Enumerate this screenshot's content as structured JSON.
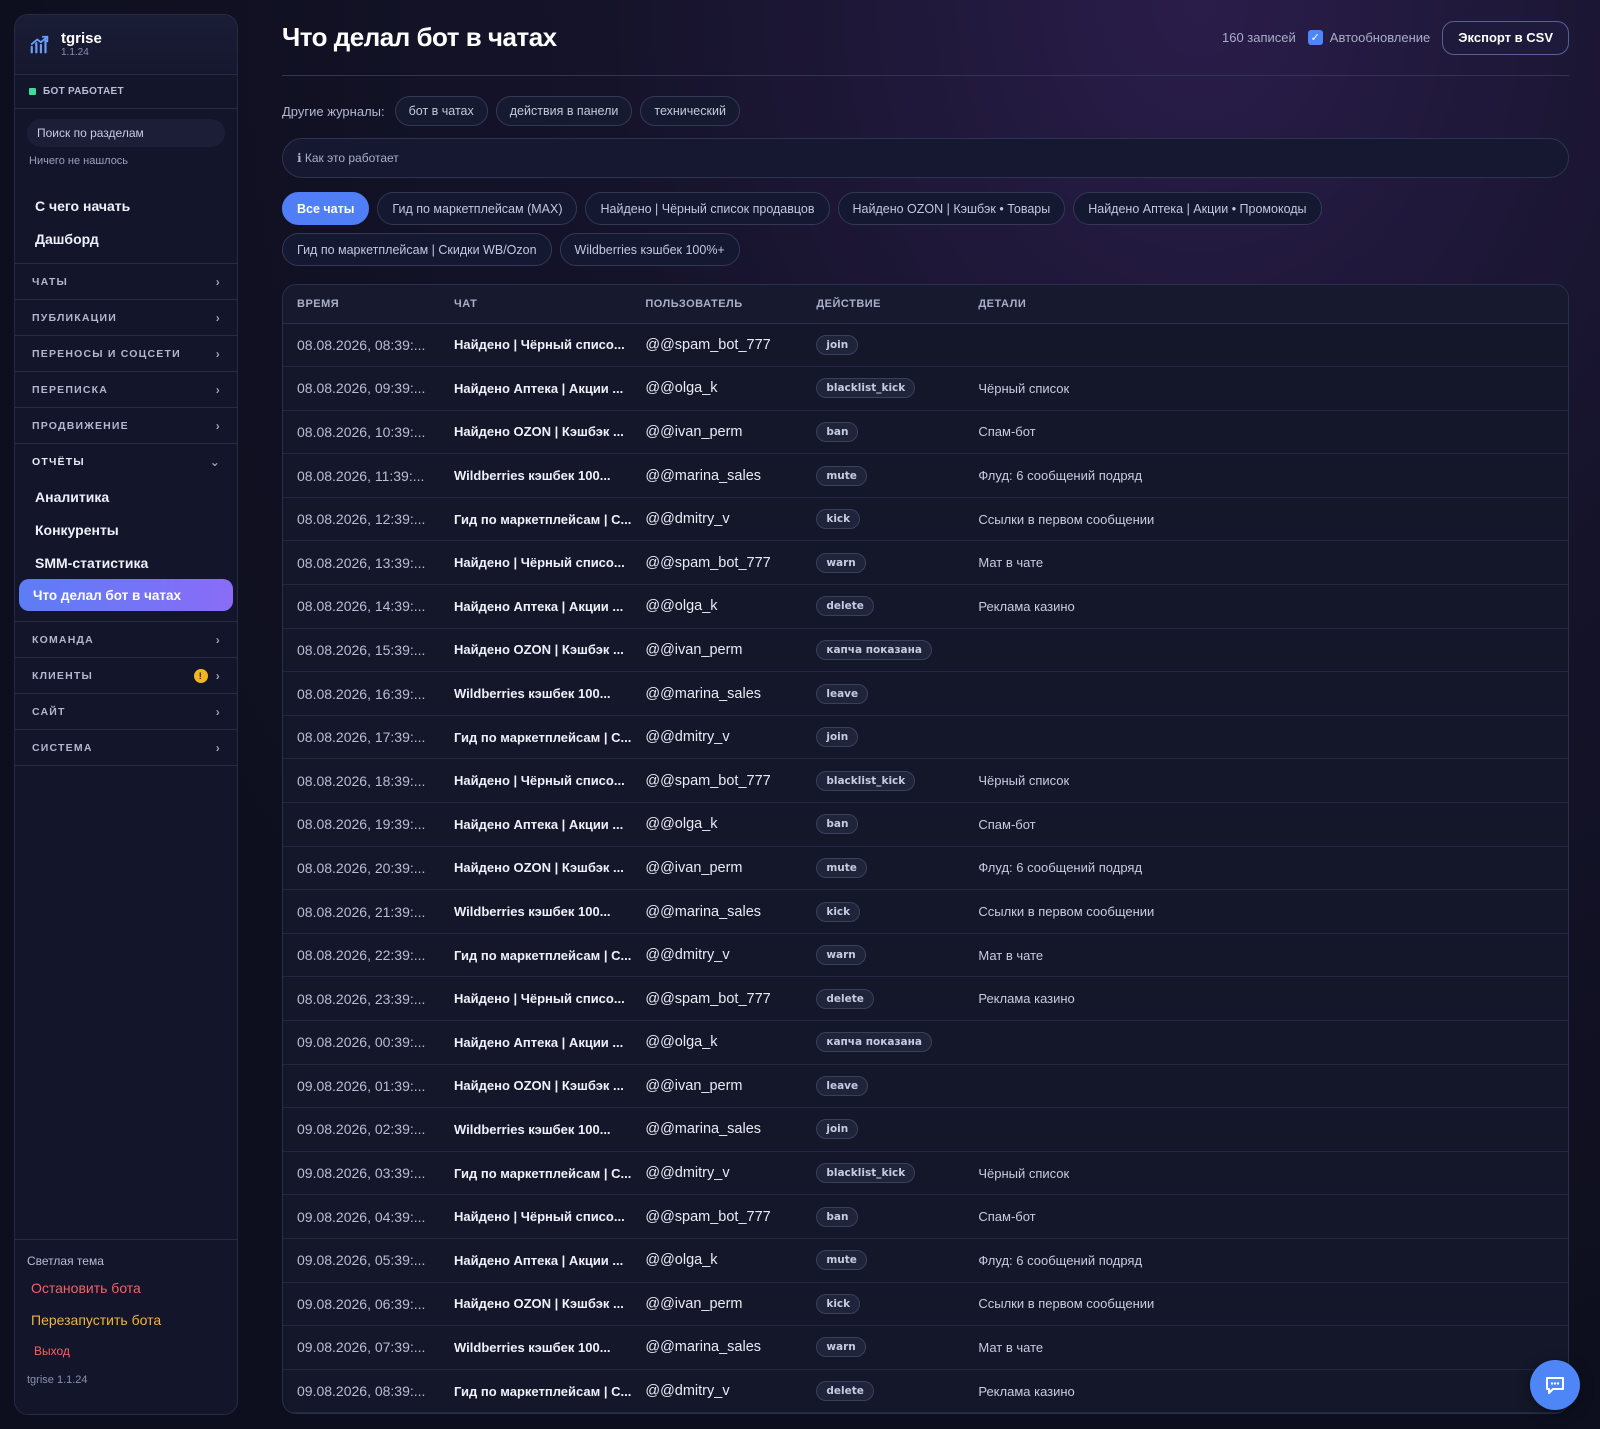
{
  "brand": {
    "name": "tgrise",
    "version": "1.1.24"
  },
  "sidebar": {
    "status": "БОТ РАБОТАЕТ",
    "search_placeholder": "Поиск по разделам",
    "no_results": "Ничего не нашлось",
    "top_links": [
      "С чего начать",
      "Дашборд"
    ],
    "sections_before": [
      "ЧАТЫ",
      "ПУБЛИКАЦИИ",
      "ПЕРЕНОСЫ И СОЦСЕТИ",
      "ПЕРЕПИСКА",
      "ПРОДВИЖЕНИЕ"
    ],
    "open_section": "ОТЧЁТЫ",
    "open_items": [
      "Аналитика",
      "Конкуренты",
      "SMM-статистика",
      "Что делал бот в чатах"
    ],
    "sections_after": [
      "КОМАНДА",
      "КЛИЕНТЫ",
      "САЙТ",
      "СИСТЕМА"
    ],
    "clients_badge": "!",
    "footer": {
      "theme": "Светлая тема",
      "stop": "Остановить бота",
      "restart": "Перезапустить бота",
      "logout": "Выход",
      "version": "tgrise 1.1.24"
    }
  },
  "header": {
    "title": "Что делал бот в чатах",
    "count": "160 записей",
    "auto_refresh": "Автообновление",
    "auto_refresh_checked": true,
    "export": "Экспорт в CSV"
  },
  "journals": {
    "label": "Другие журналы:",
    "items": [
      "бот в чатах",
      "действия в панели",
      "технический"
    ]
  },
  "howto": "ℹ Как это работает",
  "filters": [
    "Все чаты",
    "Гид по маркетплейсам (MAX)",
    "Найдено | Чёрный список продавцов",
    "Найдено OZON | Кэшбэк • Товары",
    "Найдено Аптека | Акции • Промокоды",
    "Гид по маркетплейсам | Скидки WB/Ozon",
    "Wildberries кэшбек 100%+"
  ],
  "table": {
    "columns": [
      "ВРЕМЯ",
      "ЧАТ",
      "ПОЛЬЗОВАТЕЛЬ",
      "ДЕЙСТВИЕ",
      "ДЕТАЛИ"
    ],
    "rows": [
      [
        "08.08.2026, 08:39:...",
        "Найдено | Чёрный списо...",
        "@@spam_bot_777",
        "join",
        ""
      ],
      [
        "08.08.2026, 09:39:...",
        "Найдено Аптека | Акции ...",
        "@@olga_k",
        "blacklist_kick",
        "Чёрный список"
      ],
      [
        "08.08.2026, 10:39:...",
        "Найдено OZON | Кэшбэк ...",
        "@@ivan_perm",
        "ban",
        "Спам-бот"
      ],
      [
        "08.08.2026, 11:39:...",
        "Wildberries кэшбек 100...",
        "@@marina_sales",
        "mute",
        "Флуд: 6 сообщений подряд"
      ],
      [
        "08.08.2026, 12:39:...",
        "Гид по маркетплейсам | С...",
        "@@dmitry_v",
        "kick",
        "Ссылки в первом сообщении"
      ],
      [
        "08.08.2026, 13:39:...",
        "Найдено | Чёрный списо...",
        "@@spam_bot_777",
        "warn",
        "Мат в чате"
      ],
      [
        "08.08.2026, 14:39:...",
        "Найдено Аптека | Акции ...",
        "@@olga_k",
        "delete",
        "Реклама казино"
      ],
      [
        "08.08.2026, 15:39:...",
        "Найдено OZON | Кэшбэк ...",
        "@@ivan_perm",
        "капча показана",
        ""
      ],
      [
        "08.08.2026, 16:39:...",
        "Wildberries кэшбек 100...",
        "@@marina_sales",
        "leave",
        ""
      ],
      [
        "08.08.2026, 17:39:...",
        "Гид по маркетплейсам | С...",
        "@@dmitry_v",
        "join",
        ""
      ],
      [
        "08.08.2026, 18:39:...",
        "Найдено | Чёрный списо...",
        "@@spam_bot_777",
        "blacklist_kick",
        "Чёрный список"
      ],
      [
        "08.08.2026, 19:39:...",
        "Найдено Аптека | Акции ...",
        "@@olga_k",
        "ban",
        "Спам-бот"
      ],
      [
        "08.08.2026, 20:39:...",
        "Найдено OZON | Кэшбэк ...",
        "@@ivan_perm",
        "mute",
        "Флуд: 6 сообщений подряд"
      ],
      [
        "08.08.2026, 21:39:...",
        "Wildberries кэшбек 100...",
        "@@marina_sales",
        "kick",
        "Ссылки в первом сообщении"
      ],
      [
        "08.08.2026, 22:39:...",
        "Гид по маркетплейсам | С...",
        "@@dmitry_v",
        "warn",
        "Мат в чате"
      ],
      [
        "08.08.2026, 23:39:...",
        "Найдено | Чёрный списо...",
        "@@spam_bot_777",
        "delete",
        "Реклама казино"
      ],
      [
        "09.08.2026, 00:39:...",
        "Найдено Аптека | Акции ...",
        "@@olga_k",
        "капча показана",
        ""
      ],
      [
        "09.08.2026, 01:39:...",
        "Найдено OZON | Кэшбэк ...",
        "@@ivan_perm",
        "leave",
        ""
      ],
      [
        "09.08.2026, 02:39:...",
        "Wildberries кэшбек 100...",
        "@@marina_sales",
        "join",
        ""
      ],
      [
        "09.08.2026, 03:39:...",
        "Гид по маркетплейсам | С...",
        "@@dmitry_v",
        "blacklist_kick",
        "Чёрный список"
      ],
      [
        "09.08.2026, 04:39:...",
        "Найдено | Чёрный списо...",
        "@@spam_bot_777",
        "ban",
        "Спам-бот"
      ],
      [
        "09.08.2026, 05:39:...",
        "Найдено Аптека | Акции ...",
        "@@olga_k",
        "mute",
        "Флуд: 6 сообщений подряд"
      ],
      [
        "09.08.2026, 06:39:...",
        "Найдено OZON | Кэшбэк ...",
        "@@ivan_perm",
        "kick",
        "Ссылки в первом сообщении"
      ],
      [
        "09.08.2026, 07:39:...",
        "Wildberries кэшбек 100...",
        "@@marina_sales",
        "warn",
        "Мат в чате"
      ],
      [
        "09.08.2026, 08:39:...",
        "Гид по маркетплейсам | С...",
        "@@dmitry_v",
        "delete",
        "Реклама казино"
      ]
    ]
  },
  "colors": {
    "accent": "#4f86f7",
    "danger": "#f26464",
    "warning": "#f0b43c",
    "status_ok": "#3ddc97"
  },
  "icons": {
    "brand": "chart-growth-icon",
    "fab": "chat-bubble-icon"
  }
}
